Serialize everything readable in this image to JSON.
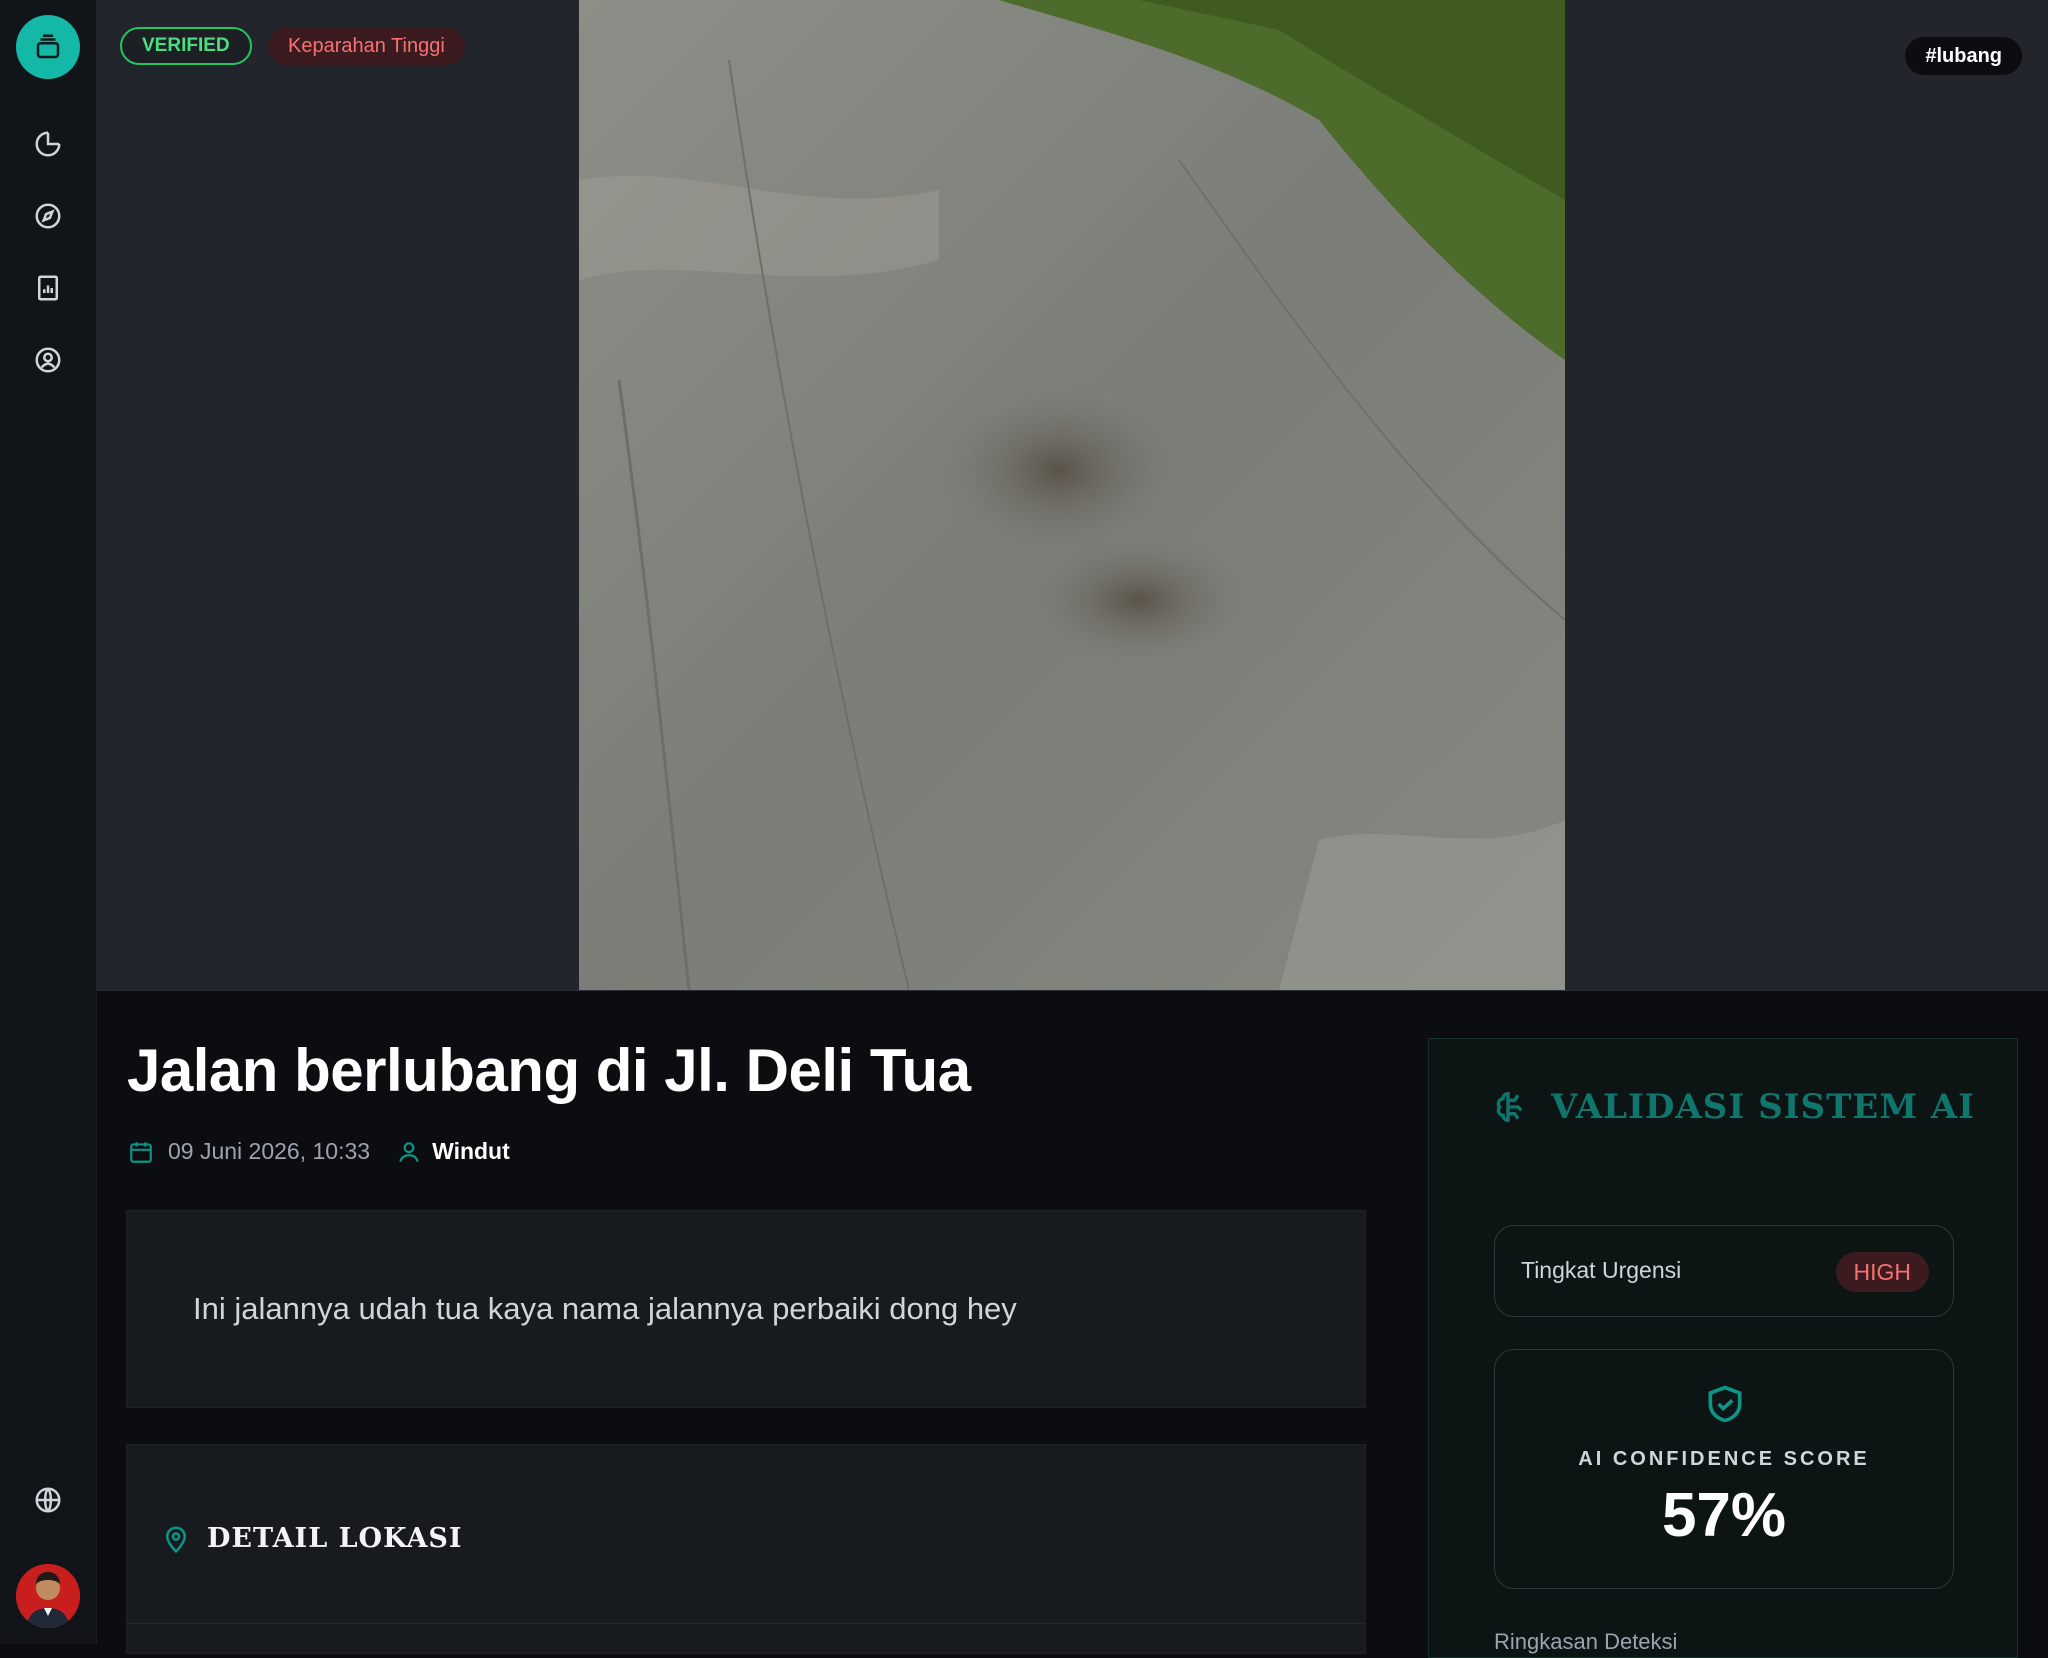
{
  "sidebar": {
    "logo_icon": "layers-icon",
    "items": [
      {
        "name": "dashboard",
        "icon": "pie-chart-icon"
      },
      {
        "name": "navigate",
        "icon": "compass-icon"
      },
      {
        "name": "reports",
        "icon": "report-icon"
      },
      {
        "name": "profile",
        "icon": "user-circle-icon"
      }
    ],
    "bottom": {
      "language_icon": "globe-icon",
      "avatar": "user-avatar"
    }
  },
  "hero": {
    "status_badge": "VERIFIED",
    "severity_badge": "Keparahan Tinggi",
    "tag": "#lubang"
  },
  "report": {
    "title": "Jalan berlubang di Jl. Deli Tua",
    "date": "09 Juni 2026, 10:33",
    "author": "Windut",
    "description": "Ini jalannya udah tua kaya nama jalannya perbaiki dong hey"
  },
  "location": {
    "heading": "DETAIL LOKASI"
  },
  "ai_validation": {
    "heading": "VALIDASI SISTEM AI",
    "urgency_label": "Tingkat Urgensi",
    "urgency_value": "HIGH",
    "confidence_label": "AI CONFIDENCE SCORE",
    "confidence_value": "57%",
    "footer_partial": "Ringkasan Deteksi"
  },
  "colors": {
    "accent": "#14b8a6",
    "verified": "#22c55e",
    "danger": "#f87171",
    "ai_heading": "#0f766e"
  }
}
